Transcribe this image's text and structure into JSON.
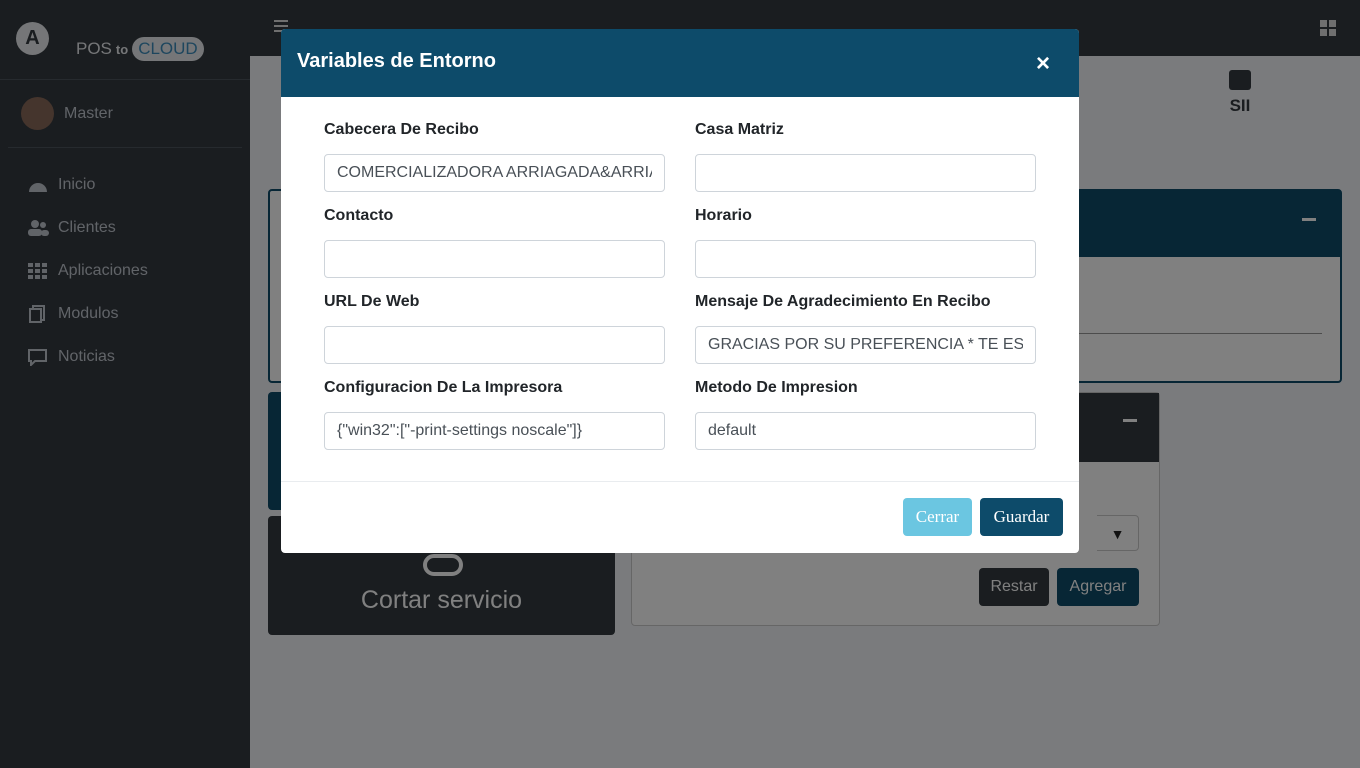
{
  "brand": {
    "pos": "POS",
    "to": "to",
    "cloud": "CLOUD"
  },
  "user": {
    "name": "Master"
  },
  "sidebar": {
    "items": [
      {
        "label": "Inicio",
        "icon": "dashboard-icon"
      },
      {
        "label": "Clientes",
        "icon": "users-icon"
      },
      {
        "label": "Aplicaciones",
        "icon": "grid-icon"
      },
      {
        "label": "Modulos",
        "icon": "copy-icon"
      },
      {
        "label": "Noticias",
        "icon": "comment-icon"
      }
    ]
  },
  "content": {
    "sii_label": "SII",
    "cortar_label": "Cortar servicio",
    "restar_label": "Restar",
    "agregar_label": "Agregar",
    "select_arrow": "▼"
  },
  "modal": {
    "title": "Variables de Entorno",
    "close_symbol": "×",
    "fields": [
      {
        "label": "Cabecera De Recibo",
        "value": "COMERCIALIZADORA ARRIAGADA&ARRIAGADA"
      },
      {
        "label": "Casa Matriz",
        "value": ""
      },
      {
        "label": "Contacto",
        "value": ""
      },
      {
        "label": "Horario",
        "value": ""
      },
      {
        "label": "URL De Web",
        "value": ""
      },
      {
        "label": "Mensaje De Agradecimiento En Recibo",
        "value": "GRACIAS POR SU PREFERENCIA * TE ESPERAMOS"
      },
      {
        "label": "Configuracion De La Impresora",
        "value": "{\"win32\":[\"-print-settings noscale\"]}"
      },
      {
        "label": "Metodo De Impresion",
        "value": "default"
      }
    ],
    "cerrar_label": "Cerrar",
    "guardar_label": "Guardar"
  },
  "colors": {
    "primary": "#0d4b6a",
    "info": "#5bc0de",
    "dark": "#343a40"
  }
}
